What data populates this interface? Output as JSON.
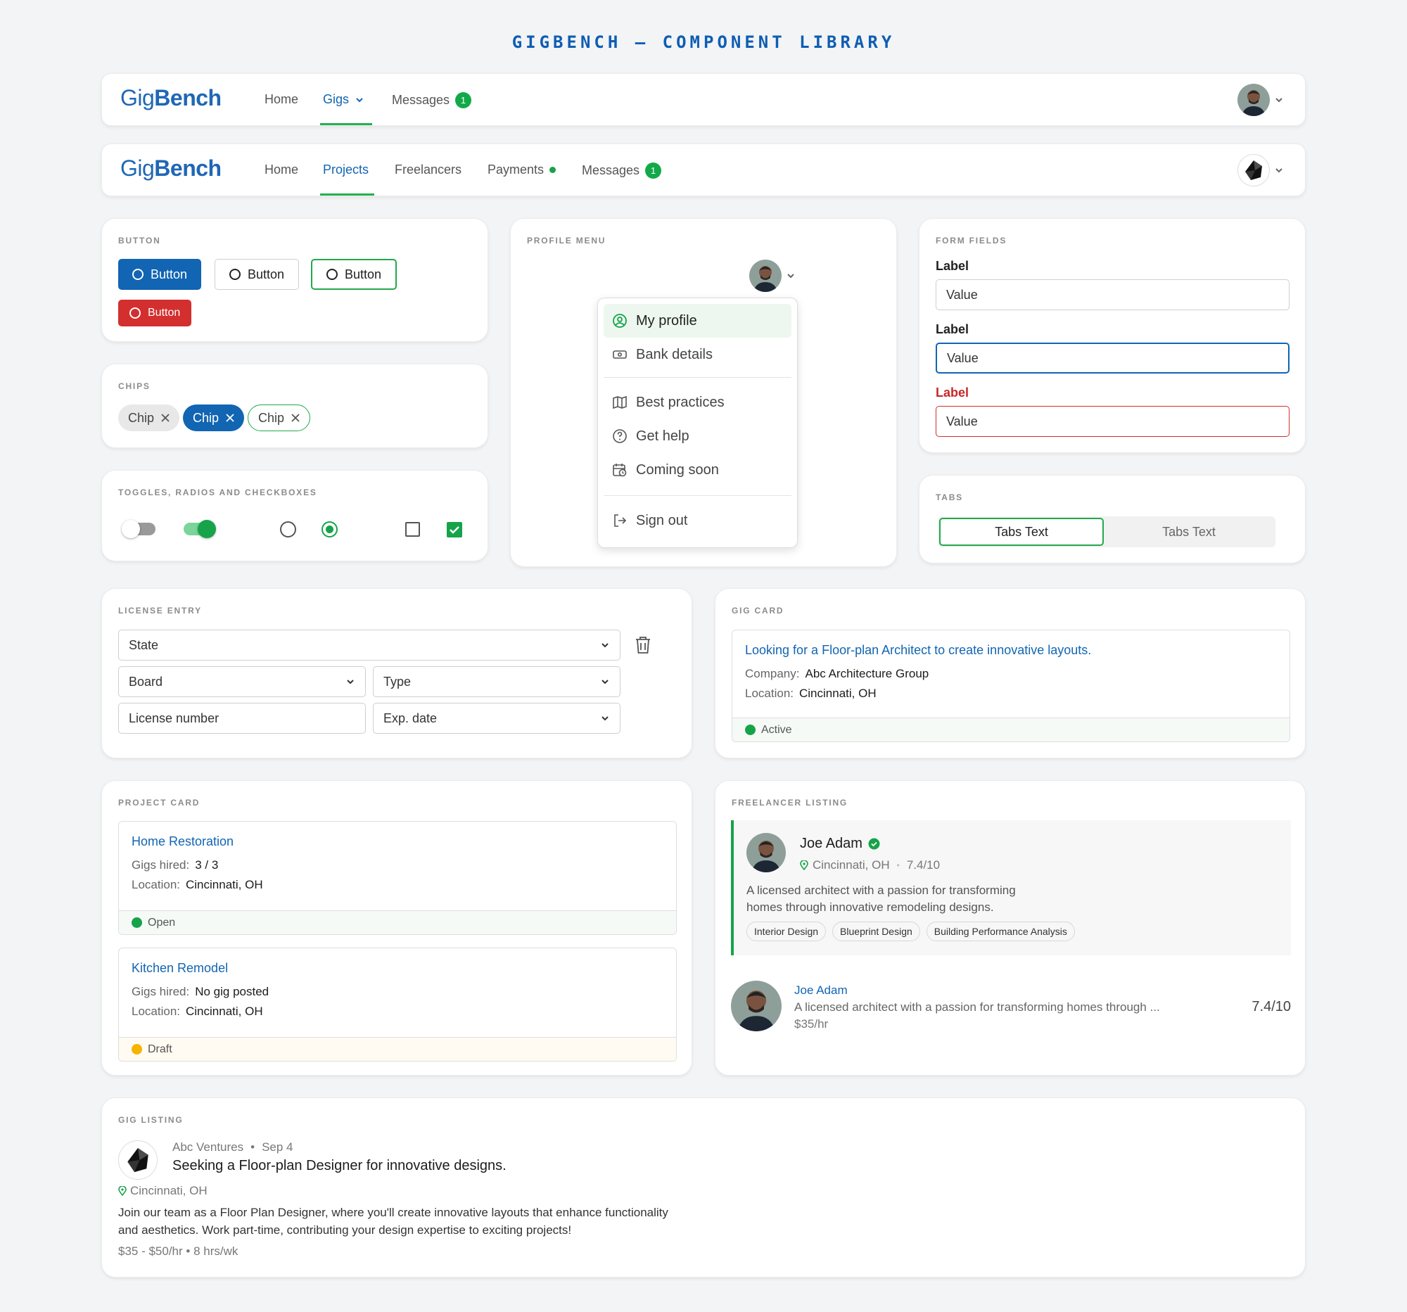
{
  "page_title": "GIGBENCH — COMPONENT LIBRARY",
  "logo": {
    "part1": "Gig",
    "part2": "Bench"
  },
  "navbar1": {
    "items": [
      "Home",
      "Gigs",
      "Messages"
    ],
    "messages_badge": "1"
  },
  "navbar2": {
    "items": [
      "Home",
      "Projects",
      "Freelancers",
      "Payments",
      "Messages"
    ],
    "messages_badge": "1"
  },
  "buttons": {
    "section_label": "BUTTON",
    "primary": "Button",
    "secondary": "Button",
    "outline": "Button",
    "danger": "Button"
  },
  "chips": {
    "section_label": "CHIPS",
    "items": [
      "Chip",
      "Chip",
      "Chip"
    ]
  },
  "toggles": {
    "section_label": "TOGGLES, RADIOS AND CHECKBOXES"
  },
  "profile_menu": {
    "section_label": "PROFILE MENU",
    "items": [
      "My profile",
      "Bank details",
      "Best practices",
      "Get help",
      "Coming soon",
      "Sign out"
    ]
  },
  "form_fields": {
    "section_label": "FORM FIELDS",
    "fields": [
      {
        "label": "Label",
        "value": "Value",
        "state": "default"
      },
      {
        "label": "Label",
        "value": "Value",
        "state": "focused"
      },
      {
        "label": "Label",
        "value": "Value",
        "state": "error"
      }
    ]
  },
  "tabs": {
    "section_label": "TABS",
    "items": [
      "Tabs Text",
      "Tabs Text"
    ]
  },
  "license_entry": {
    "section_label": "LICENSE ENTRY",
    "state": "State",
    "board": "Board",
    "type": "Type",
    "license_number": "License number",
    "exp_date": "Exp. date"
  },
  "gig_card": {
    "section_label": "GIG CARD",
    "title": "Looking for a Floor-plan Architect to create innovative layouts.",
    "company_label": "Company:",
    "company": "Abc Architecture Group",
    "location_label": "Location:",
    "location": "Cincinnati, OH",
    "status": "Active"
  },
  "project_card": {
    "section_label": "PROJECT CARD",
    "projects": [
      {
        "title": "Home Restoration",
        "gigs_label": "Gigs hired:",
        "gigs": "3 / 3",
        "location_label": "Location:",
        "location": "Cincinnati, OH",
        "status": "Open"
      },
      {
        "title": "Kitchen Remodel",
        "gigs_label": "Gigs hired:",
        "gigs": "No gig posted",
        "location_label": "Location:",
        "location": "Cincinnati, OH",
        "status": "Draft"
      }
    ]
  },
  "freelancer_listing": {
    "section_label": "FREELANCER LISTING",
    "expanded": {
      "name": "Joe Adam",
      "location": "Cincinnati, OH",
      "separator": "•",
      "rating": "7.4/10",
      "bio_line1": "A licensed architect with a passion for transforming",
      "bio_line2": "homes through innovative remodeling designs.",
      "tags": [
        "Interior Design",
        "Blueprint Design",
        "Building Performance Analysis"
      ]
    },
    "compact": {
      "name": "Joe Adam",
      "bio": "A licensed architect with a passion for transforming homes through ...",
      "rate": "$35/hr",
      "rating": "7.4/10"
    }
  },
  "gig_listing": {
    "section_label": "GIG LISTING",
    "company": "Abc Ventures",
    "separator": "•",
    "date": "Sep 4",
    "title": "Seeking a Floor-plan Designer for innovative designs.",
    "location": "Cincinnati, OH",
    "desc_line1": "Join our team as a Floor Plan Designer, where you'll create innovative layouts that enhance functionality",
    "desc_line2": "and aesthetics. Work part-time, contributing your design expertise to exciting projects!",
    "meta": "$35 - $50/hr • 8 hrs/wk"
  },
  "colors": {
    "primary": "#1165b3",
    "success": "#16a34a",
    "danger": "#d32f2f",
    "warning": "#f5b400"
  }
}
